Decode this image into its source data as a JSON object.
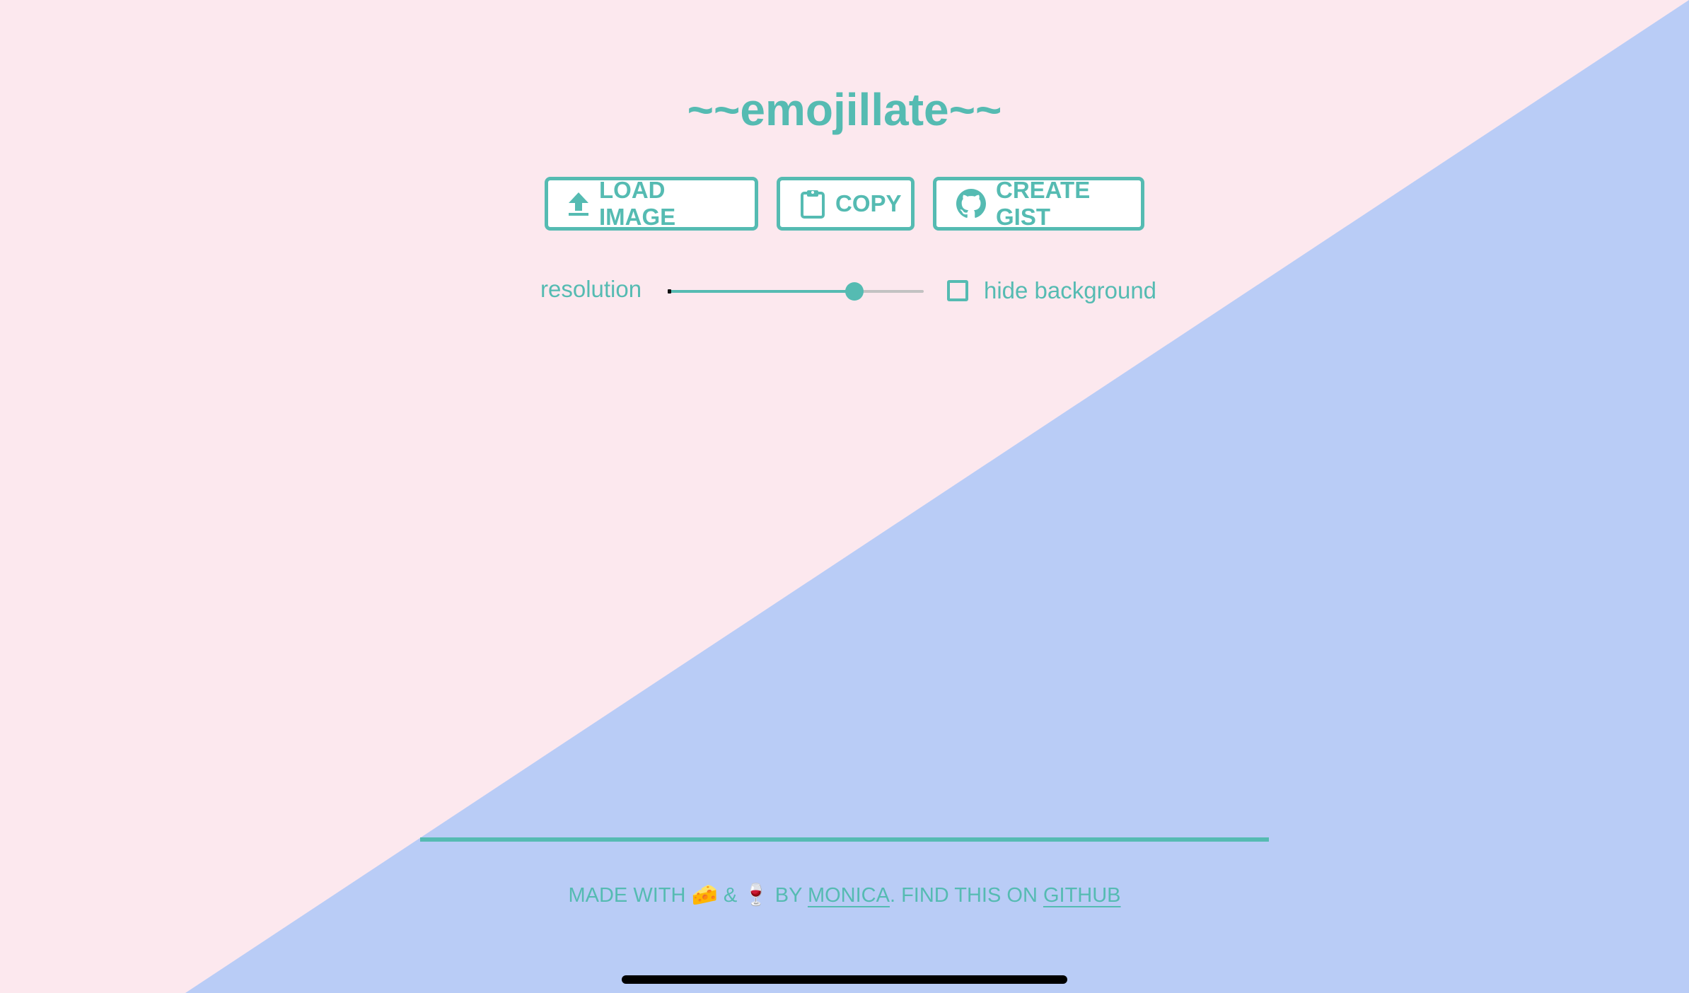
{
  "app": {
    "title": "~~emojillate~~"
  },
  "colors": {
    "accent": "#55bbb2",
    "background_pink": "#fce8ee",
    "background_blue": "#b9ccf6",
    "button_bg": "#ffffff",
    "home_indicator": "#000000"
  },
  "toolbar": {
    "load_image": {
      "label": "LOAD IMAGE",
      "icon": "upload-icon"
    },
    "copy": {
      "label": "COPY",
      "icon": "clipboard-icon"
    },
    "create_gist": {
      "label": "CREATE GIST",
      "icon": "github-icon"
    }
  },
  "controls": {
    "resolution_label": "resolution",
    "resolution_value_fraction": 0.73,
    "hide_background_label": "hide background",
    "hide_background_checked": false
  },
  "footer": {
    "made_with": "MADE WITH",
    "emoji_cheese": "🧀",
    "ampersand": "&",
    "emoji_wine": "🍷",
    "by": "BY",
    "author_link": "MONICA",
    "find_text": ". FIND THIS ON",
    "github_link": "GITHUB"
  }
}
